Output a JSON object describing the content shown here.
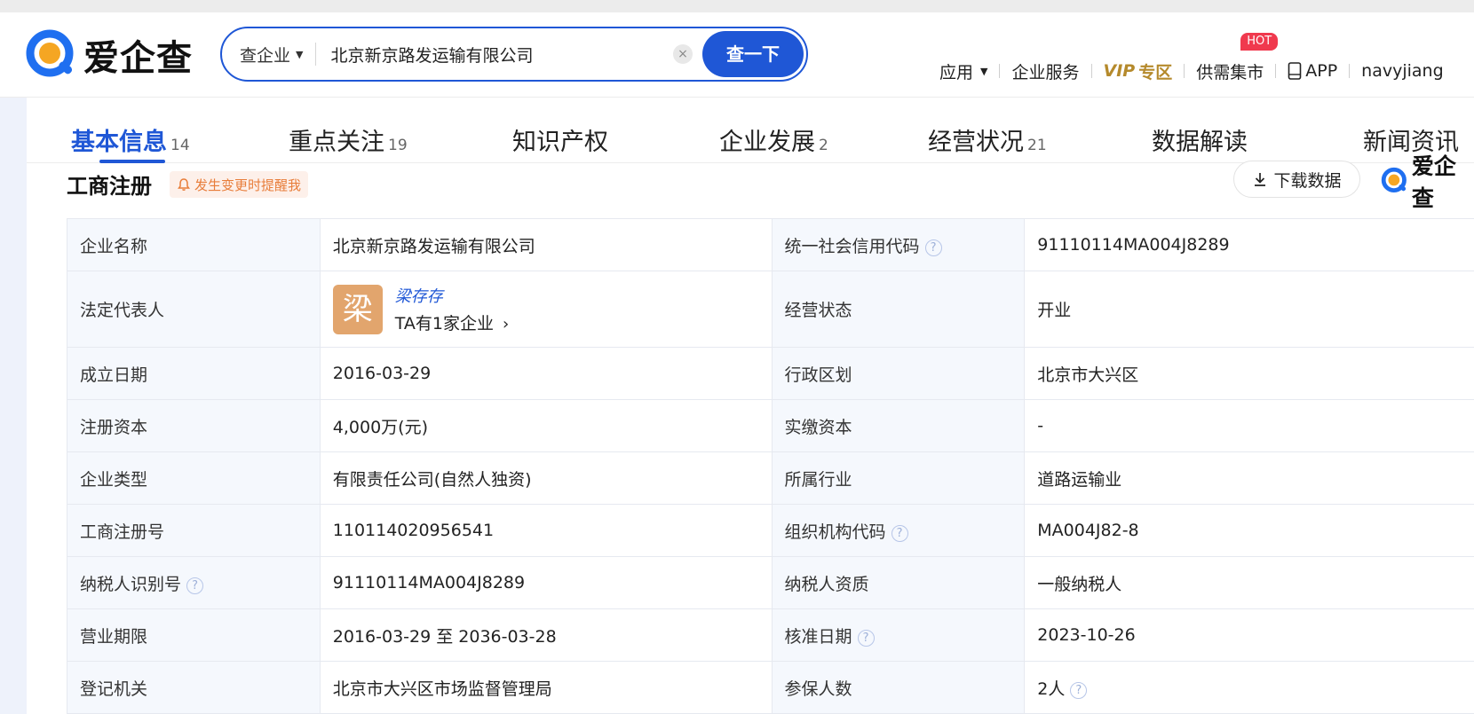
{
  "header": {
    "logo_text": "爱企查",
    "search": {
      "type_label": "查企业",
      "value": "北京新京路发运输有限公司",
      "clear_glyph": "×",
      "button_label": "查一下"
    },
    "nav": {
      "apps": "应用",
      "enterprise_service": "企业服务",
      "vip_a": "VIP",
      "vip_b": "专区",
      "supply": "供需集市",
      "hot_badge": "HOT",
      "app": "APP",
      "user": "navyjiang"
    }
  },
  "tabs": [
    {
      "label": "基本信息",
      "count": "14"
    },
    {
      "label": "重点关注",
      "count": "19"
    },
    {
      "label": "知识产权",
      "count": ""
    },
    {
      "label": "企业发展",
      "count": "2"
    },
    {
      "label": "经营状况",
      "count": "21"
    },
    {
      "label": "数据解读",
      "count": ""
    },
    {
      "label": "新闻资讯",
      "count": ""
    }
  ],
  "section": {
    "title": "工商注册",
    "remind": "发生变更时提醒我",
    "download": "下载数据",
    "watermark": "爱企查"
  },
  "registration": {
    "company_name": {
      "label": "企业名称",
      "value": "北京新京路发运输有限公司"
    },
    "credit_code": {
      "label": "统一社会信用代码",
      "value": "91110114MA004J8289"
    },
    "legal_rep": {
      "label": "法定代表人",
      "avatar_char": "梁",
      "name": "梁存存",
      "sub": "TA有1家企业"
    },
    "status": {
      "label": "经营状态",
      "value": "开业"
    },
    "founded": {
      "label": "成立日期",
      "value": "2016-03-29"
    },
    "region": {
      "label": "行政区划",
      "value": "北京市大兴区"
    },
    "capital": {
      "label": "注册资本",
      "value": "4,000万(元)"
    },
    "paid_capital": {
      "label": "实缴资本",
      "value": "-"
    },
    "type": {
      "label": "企业类型",
      "value": "有限责任公司(自然人独资)"
    },
    "industry": {
      "label": "所属行业",
      "value": "道路运输业"
    },
    "reg_no": {
      "label": "工商注册号",
      "value": "110114020956541"
    },
    "org_code": {
      "label": "组织机构代码",
      "value": "MA004J82-8"
    },
    "taxpayer_id": {
      "label": "纳税人识别号",
      "value": "91110114MA004J8289"
    },
    "taxpayer_qual": {
      "label": "纳税人资质",
      "value": "一般纳税人"
    },
    "term": {
      "label": "营业期限",
      "value": "2016-03-29 至 2036-03-28"
    },
    "approval_date": {
      "label": "核准日期",
      "value": "2023-10-26"
    },
    "authority": {
      "label": "登记机关",
      "value": "北京市大兴区市场监督管理局"
    },
    "insured": {
      "label": "参保人数",
      "value": "2人"
    }
  }
}
